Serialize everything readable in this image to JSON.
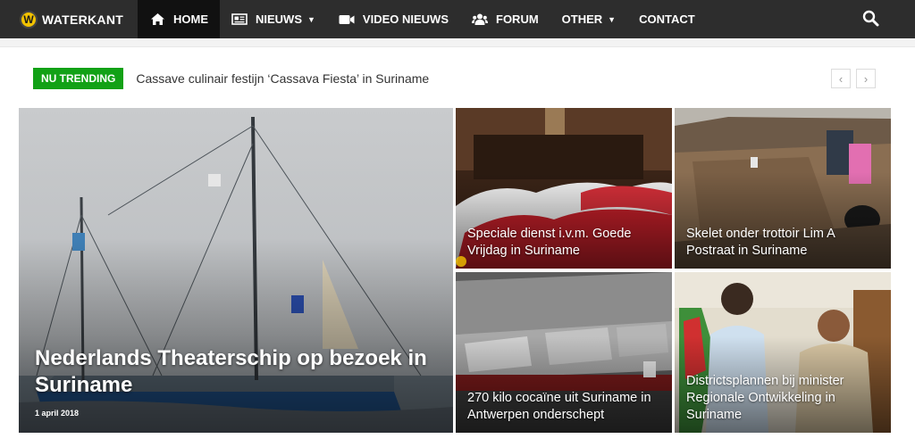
{
  "navbar": {
    "logo_mark": "W",
    "logo_text": "WATERKANT",
    "items": [
      {
        "label": "HOME",
        "icon": "home-icon"
      },
      {
        "label": "NIEUWS",
        "icon": "newspaper-icon"
      },
      {
        "label": "VIDEO NIEUWS",
        "icon": "video-camera-icon"
      },
      {
        "label": "FORUM",
        "icon": "users-icon"
      },
      {
        "label": "OTHER"
      },
      {
        "label": "CONTACT"
      }
    ],
    "search_icon": "search-icon"
  },
  "trending": {
    "badge": "NU TRENDING",
    "headline": "Cassave culinair festijn ‘Cassava Fiesta’ in Suriname",
    "prev": "‹",
    "next": "›"
  },
  "featured": {
    "title": "Nederlands Theaterschip op bezoek in Suriname",
    "date": "1 april 2018"
  },
  "tiles": [
    {
      "title": "Speciale dienst i.v.m. Goede Vrijdag in Suriname"
    },
    {
      "title": "Skelet onder trottoir Lim A Postraat in Suriname"
    },
    {
      "title": "270 kilo cocaïne uit Suriname in Antwerpen onderschept"
    },
    {
      "title": "Districtsplannen bij minister Regionale Ontwikkeling in Suriname"
    }
  ],
  "colors": {
    "navbar": "#2d2d2d",
    "active_nav": "#111111",
    "trending_badge": "#12a116",
    "logo": "#f2c200"
  }
}
